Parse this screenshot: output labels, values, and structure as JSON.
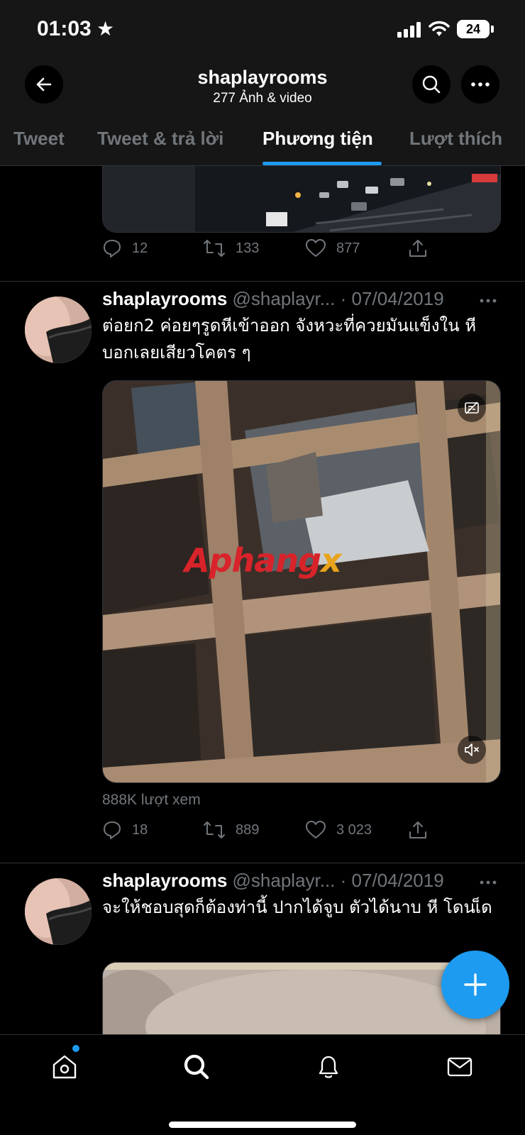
{
  "status_bar": {
    "time": "01:03",
    "battery": "24"
  },
  "header": {
    "title": "shaplayrooms",
    "subtitle": "277 Ảnh & video",
    "icons": {
      "back": "arrow-left-icon",
      "search": "search-icon",
      "more": "more-horizontal-icon"
    }
  },
  "tabs": [
    {
      "label": "Tweet"
    },
    {
      "label": "Tweet & trả lời"
    },
    {
      "label": "Phương tiện",
      "active": true
    },
    {
      "label": "Lượt thích"
    }
  ],
  "tweets": [
    {
      "media": "city street at night (partial)",
      "stats": {
        "replies": "12",
        "retweets": "133",
        "likes": "877"
      }
    },
    {
      "name": "shaplayrooms",
      "handle": "@shaplayr...",
      "date": "· 07/04/2019",
      "text": "ต่อยก2 ค่อยๆรูดหีเข้าออก จังหวะที่ควยมันแข็งใน หี บอกเลยเสียวโคตร ๆ",
      "watermark": {
        "part1": "Aphang",
        "part2": "x"
      },
      "views": "888K lượt xem",
      "stats": {
        "replies": "18",
        "retweets": "889",
        "likes": "3 023"
      }
    },
    {
      "name": "shaplayrooms",
      "handle": "@shaplayr...",
      "date": "· 07/04/2019",
      "text": "จะให้ชอบสุดก็ต้องท่านี้ ปากได้จูบ ตัวได้นาบ หี โดนเ็ด"
    }
  ],
  "bottom_nav": [
    {
      "icon": "home-icon",
      "has_notification_dot": true
    },
    {
      "icon": "search-icon",
      "active": true
    },
    {
      "icon": "bell-icon"
    },
    {
      "icon": "mail-icon"
    }
  ],
  "fab": {
    "icon": "plus-icon"
  },
  "colors": {
    "accent": "#1d9bf0",
    "background": "#000000",
    "header_bg": "#161616",
    "muted": "#71767b"
  }
}
